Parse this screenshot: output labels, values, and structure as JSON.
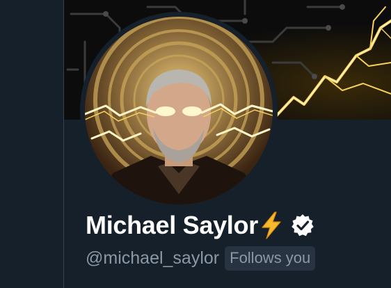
{
  "profile": {
    "display_name": "Michael Saylor",
    "handle": "@michael_saylor",
    "follows_you_label": "Follows you",
    "name_emoji": "lightning-bolt-emoji",
    "verified": true
  },
  "icons": {
    "verified": "verified-badge-icon",
    "name_emoji": "lightning-icon"
  },
  "colors": {
    "background": "#15202b",
    "divider": "#38444d",
    "name_text": "#ffffff",
    "secondary_text": "#8b98a5",
    "badge_background": "#273340",
    "lightning": "#f5c542"
  }
}
